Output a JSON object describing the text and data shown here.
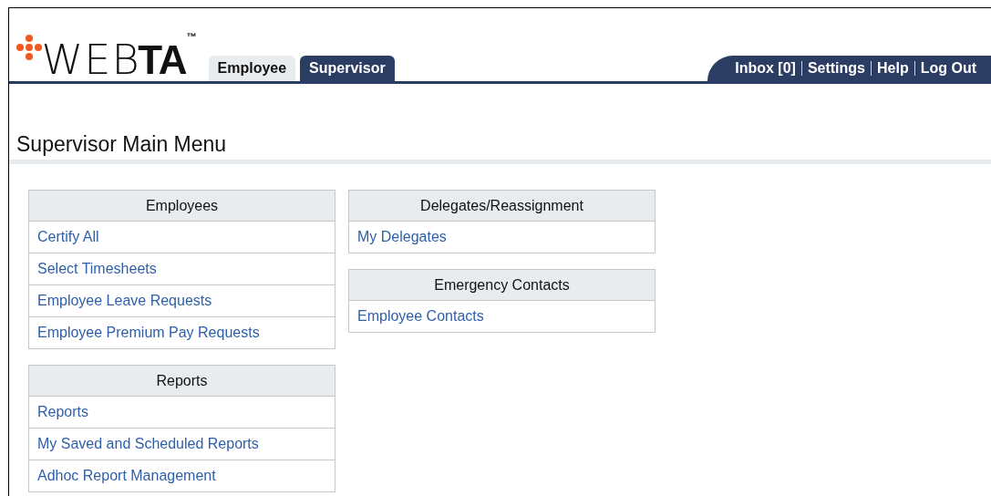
{
  "logo": {
    "light": "WEB",
    "bold": "TA",
    "mark": "™"
  },
  "tabs": [
    {
      "label": "Employee",
      "selected": false
    },
    {
      "label": "Supervisor",
      "selected": true
    }
  ],
  "top_links": [
    "Inbox [0]",
    "Settings",
    "Help",
    "Log Out"
  ],
  "page_title": "Supervisor Main Menu",
  "columns": [
    [
      {
        "title": "Employees",
        "items": [
          "Certify All",
          "Select Timesheets",
          "Employee Leave Requests",
          "Employee Premium Pay Requests"
        ]
      },
      {
        "title": "Reports",
        "items": [
          "Reports",
          "My Saved and Scheduled Reports",
          "Adhoc Report Management"
        ]
      }
    ],
    [
      {
        "title": "Delegates/Reassignment",
        "items": [
          "My Delegates"
        ]
      },
      {
        "title": "Emergency Contacts",
        "items": [
          "Employee Contacts"
        ]
      }
    ]
  ]
}
